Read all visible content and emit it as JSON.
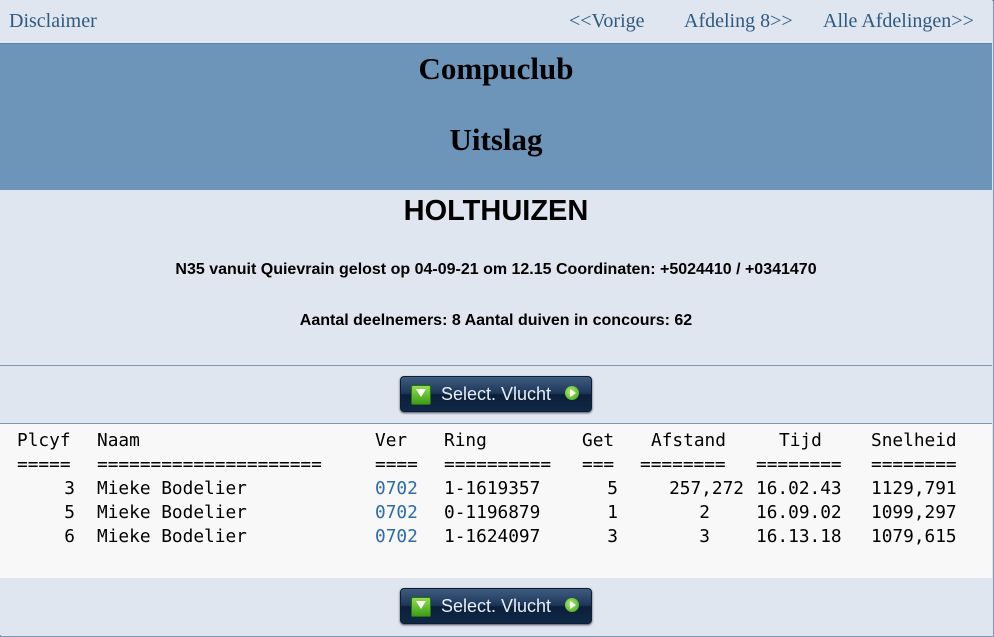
{
  "nav": {
    "disclaimer": "Disclaimer",
    "prev": "<<Vorige",
    "next": "Afdeling 8>>",
    "all": "Alle Afdelingen>>"
  },
  "banner": {
    "club": "Compuclub",
    "subtitle": "Uitslag"
  },
  "info": {
    "place": "HOLTHUIZEN",
    "flight": "N35 vanuit Quievrain gelost op 04-09-21 om 12.15 Coordinaten: +5024410 / +0341470",
    "counts": "Aantal deelnemers: 8 Aantal duiven in concours: 62"
  },
  "button": {
    "label": "Select. Vlucht"
  },
  "table": {
    "headers": {
      "plcyf": "Plcyf",
      "naam": "Naam",
      "ver": "Ver",
      "ring": "Ring",
      "get": "Get",
      "afstand": "Afstand",
      "tijd": "Tijd",
      "snelheid": "Snelheid"
    },
    "separators": {
      "plcyf": "=====",
      "naam": "=====================",
      "ver": "====",
      "ring": "==========",
      "get": "===",
      "afstand": "========",
      "tijd": "========",
      "snelheid": "========"
    },
    "rows": [
      {
        "plcyf": "3",
        "naam": "Mieke Bodelier",
        "ver": "0702",
        "ring": "1-1619357",
        "get": "5",
        "afstand": "257,272",
        "tijd": "16.02.43",
        "snelheid": "1129,791"
      },
      {
        "plcyf": "5",
        "naam": "Mieke Bodelier",
        "ver": "0702",
        "ring": "0-1196879",
        "get": "1",
        "afstand": "2",
        "tijd": "16.09.02",
        "snelheid": "1099,297"
      },
      {
        "plcyf": "6",
        "naam": "Mieke Bodelier",
        "ver": "0702",
        "ring": "1-1624097",
        "get": "3",
        "afstand": "3",
        "tijd": "16.13.18",
        "snelheid": "1079,615"
      }
    ]
  },
  "colors": {
    "banner": "#6d94b9",
    "panel": "#dfe6f0",
    "link": "#2e5a80",
    "ver_link": "#2e6ba8"
  }
}
